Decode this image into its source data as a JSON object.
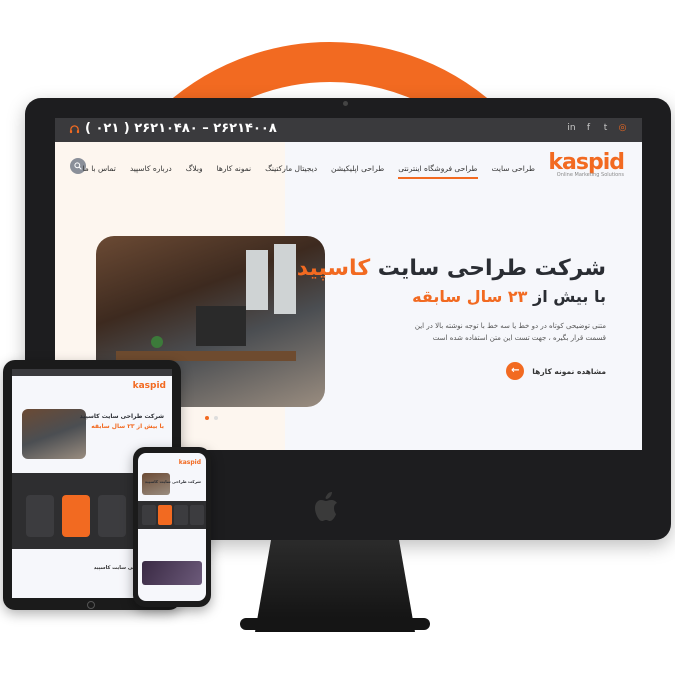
{
  "colors": {
    "accent": "#f26a21",
    "dark": "#3a3a3d",
    "text": "#2a2d33"
  },
  "topbar": {
    "phone": "( ۰۲۱ )  ۲۶۲۱۰۴۸۰ – ۲۶۲۱۴۰۰۸",
    "social_icons": [
      "linkedin-icon",
      "facebook-icon",
      "twitter-icon",
      "instagram-icon"
    ]
  },
  "logo": {
    "brand": "kaspid",
    "tagline": "Online Marketing Solutions"
  },
  "nav": {
    "items": [
      "طراحی سایت",
      "طراحی فروشگاه اینترنتی",
      "طراحی اپلیکیشن",
      "دیجیتال مارکتینگ",
      "نمونه کارها",
      "وبلاگ",
      "درباره کاسپید",
      "تماس با ما"
    ],
    "active_index": 1
  },
  "hero": {
    "title_prefix": "شرکت طراحی سایت ",
    "title_accent": "کاسپید",
    "subtitle_prefix": "با بیش از ",
    "subtitle_accent": "۲۳ سال سابقه",
    "description": "متنی توضیحی کوتاه در دو خط یا سه خط با توجه نوشته بالا در این قسمت قرار بگیره ، جهت تست این متن استفاده شده است",
    "cta_label": "مشاهده نمونه کارها",
    "slider_dots": 2,
    "slider_active": 1
  },
  "tablet": {
    "brand": "kaspid",
    "title": "شرکت طراحی سایت کاسپید",
    "subtitle": "با بیش از ۲۳ سال سابقه",
    "footer_title": "شرکت طراحی سایت کاسپید"
  },
  "phone": {
    "brand": "kaspid",
    "title": "شرکت طراحی سایت کاسپید"
  }
}
